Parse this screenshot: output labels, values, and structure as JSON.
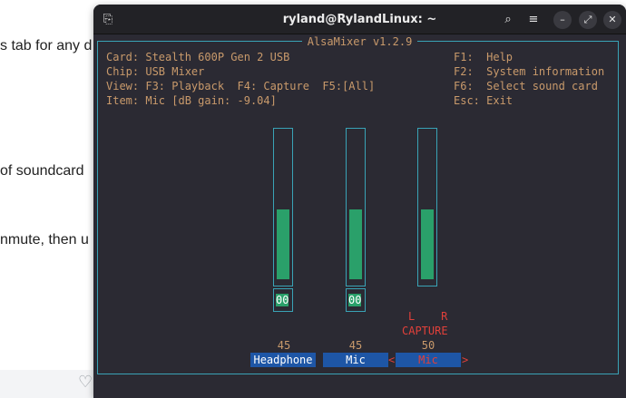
{
  "background_page": {
    "lines": [
      "s tab for any d",
      "of soundcard",
      "nmute, then u"
    ]
  },
  "window": {
    "title": "ryland@RylandLinux: ~",
    "icons": {
      "app": "terminal-icon",
      "search": "search-icon",
      "menu": "menu-icon",
      "minimize": "minimize-icon",
      "maximize": "maximize-icon",
      "close": "close-icon"
    },
    "glyphs": {
      "app": "⎘",
      "search": "⌕",
      "menu": "≡",
      "minimize": "–",
      "maximize": "⤢",
      "close": "✕"
    }
  },
  "alsamixer": {
    "title": "AlsaMixer v1.2.9",
    "card": "Card: Stealth 600P Gen 2 USB",
    "chip": "Chip: USB Mixer",
    "view": "View: F3: Playback  F4: Capture  F5:[All]",
    "item": "Item: Mic [dB gain: -9.04]",
    "help": [
      "F1:  Help",
      "F2:  System information",
      "F6:  Select sound card",
      "Esc: Exit"
    ],
    "channels": [
      {
        "name": "Headphone",
        "value": "45",
        "level": 0.45,
        "mute": "00",
        "selected": false
      },
      {
        "name": "Mic",
        "value": "45",
        "level": 0.45,
        "mute": "00",
        "selected": false
      },
      {
        "name": "Mic",
        "value": "50",
        "level": 0.45,
        "capture": "CAPTURE",
        "lr": "L    R",
        "selected": true,
        "arrow_left": "<",
        "arrow_right": ">"
      }
    ]
  },
  "colors": {
    "terminal_bg": "#2b2a33",
    "frame": "#39a3b6",
    "text": "#c99a6b",
    "bar_fill": "#2aa06a",
    "label_bg": "#1e56a6",
    "capture_red": "#e0403a"
  }
}
